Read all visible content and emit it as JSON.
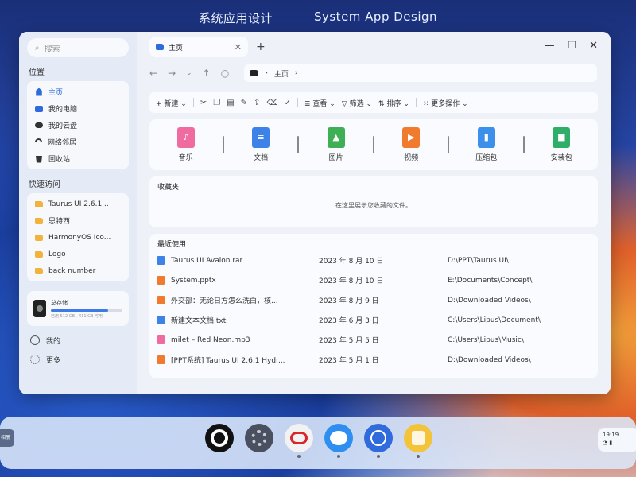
{
  "banner": {
    "left_title": "系统应用设计",
    "right_title": "System App Design"
  },
  "sidebar": {
    "search_placeholder": "搜索",
    "locations_heading": "位置",
    "locations": [
      {
        "label": "主页",
        "icon": "home-icon"
      },
      {
        "label": "我的电脑",
        "icon": "computer-icon"
      },
      {
        "label": "我的云盘",
        "icon": "cloud-icon"
      },
      {
        "label": "网络邻居",
        "icon": "network-icon"
      },
      {
        "label": "回收站",
        "icon": "trash-icon"
      }
    ],
    "quick_heading": "快速访问",
    "quick": [
      "Taurus UI 2.6.1...",
      "思特西",
      "HarmonyOS Ico...",
      "Logo",
      "back number"
    ],
    "storage_title": "总存储",
    "storage_fill": 0.8,
    "storage_sub": "已用 512 GB，411 GB 可用",
    "footer": [
      {
        "label": "我的",
        "icon": "face-icon"
      },
      {
        "label": "更多",
        "icon": "more-icon"
      }
    ]
  },
  "tab": {
    "label": "主页"
  },
  "path": {
    "label": "主页"
  },
  "toolbar": {
    "new": "新建",
    "view": "查看",
    "filter": "筛选",
    "sort": "排序",
    "more": "更多操作"
  },
  "categories": [
    {
      "label": "音乐",
      "color": "#f06ba0",
      "glyph": "♪"
    },
    {
      "label": "文档",
      "color": "#3c82e8",
      "glyph": "≡"
    },
    {
      "label": "图片",
      "color": "#3faf55",
      "glyph": "▲"
    },
    {
      "label": "视频",
      "color": "#f07a2d",
      "glyph": "▶"
    },
    {
      "label": "压缩包",
      "color": "#3c8fea",
      "glyph": "▮"
    },
    {
      "label": "安装包",
      "color": "#2fae6a",
      "glyph": "■"
    }
  ],
  "favorites": {
    "title": "收藏夹",
    "empty": "在这里展示您收藏的文件。"
  },
  "recent": {
    "title": "最近使用",
    "rows": [
      {
        "name": "Taurus UI Avalon.rar",
        "date": "2023 年 8 月 10 日",
        "path": "D:\\PPT\\Taurus UI\\",
        "color": "#3c82e8"
      },
      {
        "name": "System.pptx",
        "date": "2023 年 8 月 10 日",
        "path": "E:\\Documents\\Concept\\",
        "color": "#f07a2d"
      },
      {
        "name": "外交部：无论日方怎么洗白，核...",
        "date": "2023 年 8 月 9 日",
        "path": "D:\\Downloaded Videos\\",
        "color": "#f07a2d"
      },
      {
        "name": "新建文本文档.txt",
        "date": "2023 年 6 月 3 日",
        "path": "C:\\Users\\Lipus\\Document\\",
        "color": "#3c82e8"
      },
      {
        "name": "milet – Red Neon.mp3",
        "date": "2023 年 5 月 5 日",
        "path": "C:\\Users\\Lipus\\Music\\",
        "color": "#f06ba0"
      },
      {
        "name": "[PPT系统] Taurus UI 2.6.1 Hydr...",
        "date": "2023 年 5 月 1 日",
        "path": "D:\\Downloaded Videos\\",
        "color": "#f07a2d"
      }
    ]
  },
  "dock": {
    "left_label": "相册",
    "status_time": "19:19",
    "apps": [
      {
        "name": "camera-app",
        "bg": "#111111",
        "inner": "#ffffff"
      },
      {
        "name": "settings-app",
        "bg": "#4a5060",
        "inner": "#c8ccd6"
      },
      {
        "name": "huawei-app",
        "bg": "#f2f2f2",
        "inner": "#d8262c"
      },
      {
        "name": "messages-app",
        "bg": "#2f8ff0",
        "inner": "#ffffff"
      },
      {
        "name": "browser-app",
        "bg": "#2f6bdc",
        "inner": "#ffffff"
      },
      {
        "name": "notes-app",
        "bg": "#f3c43a",
        "inner": "#ffffff"
      }
    ]
  }
}
